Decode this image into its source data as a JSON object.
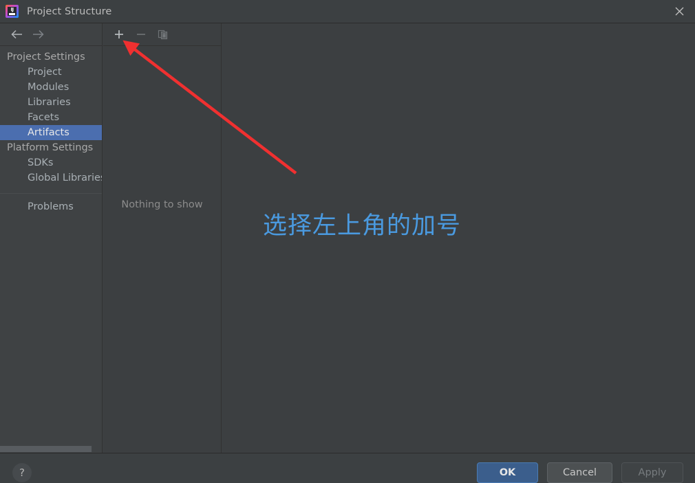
{
  "window": {
    "title": "Project Structure",
    "app_icon_name": "intellij-idea-icon",
    "app_icon_text": "IJ",
    "close_label": "×"
  },
  "nav": {
    "back_icon": "arrow-left-icon",
    "forward_icon": "arrow-right-icon"
  },
  "sidebar": {
    "groups": [
      {
        "type": "group",
        "label": "Project Settings"
      },
      {
        "type": "item",
        "label": "Project",
        "selected": false
      },
      {
        "type": "item",
        "label": "Modules",
        "selected": false
      },
      {
        "type": "item",
        "label": "Libraries",
        "selected": false
      },
      {
        "type": "item",
        "label": "Facets",
        "selected": false
      },
      {
        "type": "item",
        "label": "Artifacts",
        "selected": true
      },
      {
        "type": "group",
        "label": "Platform Settings"
      },
      {
        "type": "item",
        "label": "SDKs",
        "selected": false
      },
      {
        "type": "item",
        "label": "Global Libraries",
        "selected": false
      },
      {
        "type": "separator",
        "label": ""
      },
      {
        "type": "item",
        "label": "Problems",
        "selected": false
      }
    ]
  },
  "mid_panel": {
    "toolbar": {
      "add_icon": "plus-icon",
      "remove_icon": "minus-icon",
      "copy_icon": "copy-icon"
    },
    "empty_text": "Nothing to show"
  },
  "annotation": {
    "text": "选择左上角的加号",
    "text_color": "#4a9ae0",
    "arrow_color": "#f03030",
    "arrow_name": "red-pointer-arrow"
  },
  "footer": {
    "help_label": "?",
    "ok_label": "OK",
    "cancel_label": "Cancel",
    "apply_label": "Apply"
  },
  "colors": {
    "window_bg": "#3c3f41",
    "titlebar_bg": "#3c4042",
    "sidebar_bg": "#3f4244",
    "selection_blue": "#4b6eaf",
    "ok_button_blue": "#3b5e8c",
    "annotation_blue": "#4a9ae0",
    "arrow_red": "#f03030"
  }
}
